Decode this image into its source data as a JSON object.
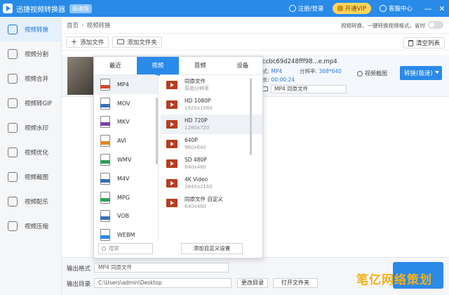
{
  "titlebar": {
    "app_title": "迅捷视频转换器",
    "badge": "极速版",
    "login": "注册/登录",
    "vip": "开通VIP",
    "help": "客服中心",
    "minimize": "—",
    "close": "✕"
  },
  "sidebar": {
    "items": [
      {
        "label": "视频转换",
        "icon": "video-convert-icon"
      },
      {
        "label": "视频分割",
        "icon": "split-icon"
      },
      {
        "label": "视频合并",
        "icon": "merge-icon"
      },
      {
        "label": "视频转GIF",
        "icon": "gif-icon"
      },
      {
        "label": "视频水印",
        "icon": "watermark-icon"
      },
      {
        "label": "视频优化",
        "icon": "optimize-icon"
      },
      {
        "label": "视频截图",
        "icon": "screenshot-icon"
      },
      {
        "label": "视频配乐",
        "icon": "music-icon"
      },
      {
        "label": "视频压缩",
        "icon": "compress-icon"
      }
    ]
  },
  "breadcrumb": {
    "home": "首页",
    "sep": "›",
    "current": "视频转换",
    "hint": "视频转换，一键转换视频格式，省时"
  },
  "toolbar": {
    "add_file": "添加文件",
    "add_folder": "添加文件夹",
    "clear_list": "清空列表"
  },
  "file": {
    "name": "ccbc69d248fff98...e.mp4",
    "fmt_label": "式:",
    "fmt_value": "MP4",
    "res_label": "分辨率:",
    "res_value": "368*640",
    "dur_label": "长:",
    "dur_value": "00:00:24",
    "output_format": "MP4 同原文件",
    "cut": "视频截图",
    "convert": "转换(极速)"
  },
  "panel": {
    "tabs": [
      "最近",
      "视频",
      "音频",
      "设备"
    ],
    "formats": [
      {
        "name": "MP4",
        "color": "#d04a2a"
      },
      {
        "name": "MOV",
        "color": "#3a6fb8"
      },
      {
        "name": "MKV",
        "color": "#7a3fb0"
      },
      {
        "name": "AVI",
        "color": "#e08a20"
      },
      {
        "name": "WMV",
        "color": "#2f9e5a"
      },
      {
        "name": "M4V",
        "color": "#3a6fb8"
      },
      {
        "name": "MPG",
        "color": "#2f9e5a"
      },
      {
        "name": "VOB",
        "color": "#3a6fb8"
      },
      {
        "name": "WEBM",
        "color": "#2a8ae8"
      }
    ],
    "resolutions": [
      {
        "name": "同原文件",
        "dim": "原始分辨率"
      },
      {
        "name": "HD 1080P",
        "dim": "1920x1080"
      },
      {
        "name": "HD 720P",
        "dim": "1280x720"
      },
      {
        "name": "640P",
        "dim": "960x640"
      },
      {
        "name": "SD 480P",
        "dim": "640x480"
      },
      {
        "name": "4K Video",
        "dim": "3840x2160"
      },
      {
        "name": "同原文件 自定义",
        "dim": "640x480"
      }
    ],
    "search_placeholder": "搜索",
    "custom_settings": "添加自定义设置"
  },
  "bottom": {
    "format_label": "输出格式",
    "format_value": "MP4 同原文件",
    "dir_label": "输出目录",
    "dir_value": "C:\\Users\\admin\\Desktop",
    "change_dir": "更改目录",
    "open_folder": "打开文件夹"
  },
  "watermark": "笔亿网络策划",
  "colors": {
    "accent": "#2a8ae8",
    "vip": "#ffd45a"
  }
}
